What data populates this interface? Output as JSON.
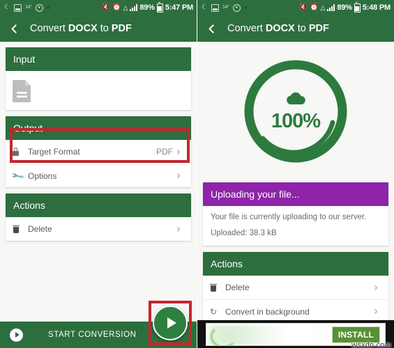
{
  "left": {
    "statusbar": {
      "icons_left": [
        "moon-icon",
        "screenshot-icon",
        "temperature-icon",
        "do-not-disturb-icon",
        "flame-icon"
      ],
      "temperature": "14°",
      "mute_icon": "mute-icon",
      "alarm_icon": "alarm-icon",
      "wifi_icon": "wifi-icon",
      "signal_icon": "signal-icon",
      "battery_pct": "89%",
      "battery_icon": "battery-icon",
      "clock": "5:47 PM"
    },
    "appbar": {
      "back_icon": "back-arrow-icon",
      "title_pre": "Convert ",
      "title_strong1": "DOCX",
      "title_mid": " to ",
      "title_strong2": "PDF"
    },
    "input_card": {
      "header": "Input",
      "file_icon": "document-icon",
      "filename": ""
    },
    "output_card": {
      "header": "Output",
      "rows": [
        {
          "icon": "lock-icon",
          "label": "Target Format",
          "value": "PDF"
        },
        {
          "icon": "wrench-icon",
          "label": "Options",
          "value": ""
        }
      ]
    },
    "actions_card": {
      "header": "Actions",
      "rows": [
        {
          "icon": "trash-icon",
          "label": "Delete",
          "value": ""
        }
      ]
    },
    "bottom_bar": {
      "play_icon": "play-icon",
      "label": "START CONVERSION"
    },
    "fab": {
      "icon": "play-icon"
    },
    "annotations": [
      {
        "name": "output-target-format-highlight"
      },
      {
        "name": "fab-highlight"
      }
    ]
  },
  "right": {
    "statusbar": {
      "temperature": "14°",
      "battery_pct": "89%",
      "clock": "5:48 PM"
    },
    "appbar": {
      "back_icon": "back-arrow-icon",
      "title_pre": "Convert ",
      "title_strong1": "DOCX",
      "title_mid": " to ",
      "title_strong2": "PDF"
    },
    "progress": {
      "cloud_icon": "cloud-upload-icon",
      "percent_label": "100%",
      "percent_value": 100
    },
    "upload_card": {
      "header": "Uploading your file...",
      "line1": "Your file is currently uploading to our server.",
      "line2": "Uploaded: 38.3 kB"
    },
    "actions_card": {
      "header": "Actions",
      "rows": [
        {
          "icon": "trash-icon",
          "label": "Delete",
          "value": ""
        },
        {
          "icon": "refresh-icon",
          "label": "Convert in background",
          "value": ""
        }
      ]
    },
    "ad": {
      "install_label": "INSTALL",
      "watermark": "wsxdn.com"
    }
  },
  "colors": {
    "green": "#2d6e3e",
    "green_accent": "#2e8040",
    "purple": "#8e24aa",
    "annotation_red": "#c1272d",
    "page_bg": "#f7f7f5"
  }
}
